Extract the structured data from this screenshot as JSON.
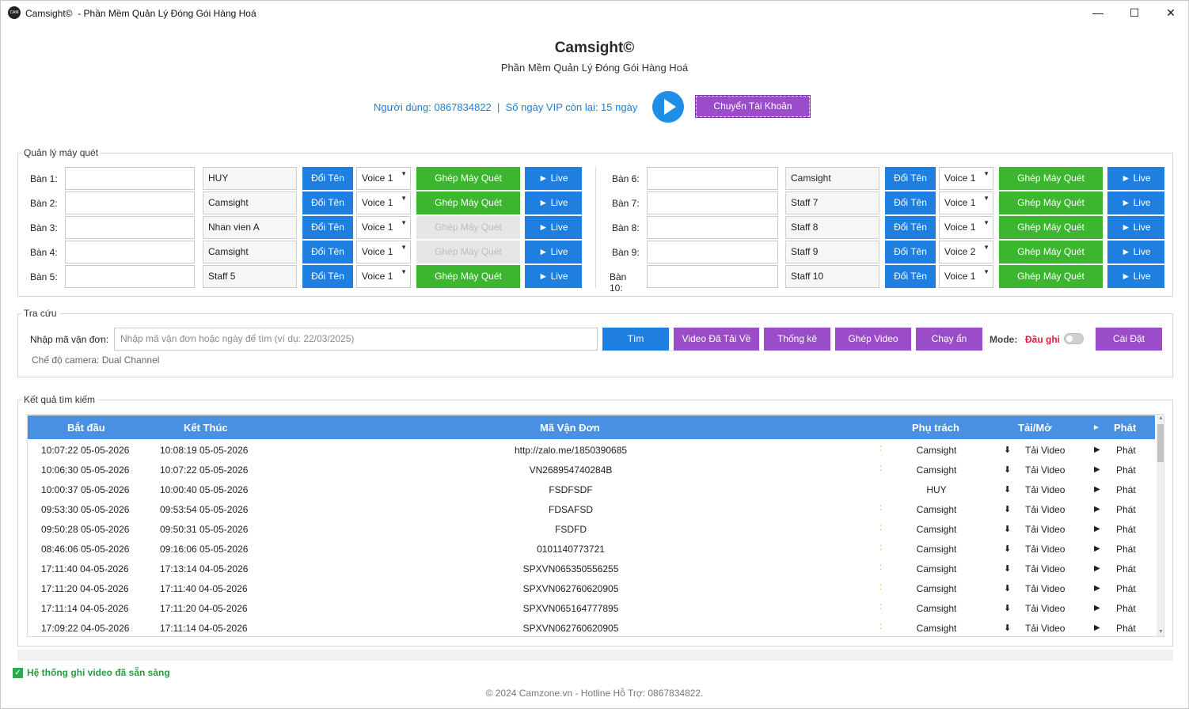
{
  "window": {
    "icon_text": "CAM",
    "title": "Camsight©  - Phần Mềm Quản Lý Đóng Gói Hàng Hoá",
    "minimize": "—",
    "maximize": "☐",
    "close": "✕"
  },
  "header": {
    "title": "Camsight©",
    "subtitle": "Phần Mềm Quản Lý Đóng Gói Hàng Hoá",
    "user_info": "Người dùng: 0867834822  |  Số ngày VIP còn lại: 15 ngày",
    "switch_account": "Chuyển Tài Khoản"
  },
  "scanners": {
    "group_label": "Quản lý máy quét",
    "rename_label": "Đổi Tên",
    "pair_label": "Ghép Máy Quét",
    "live_label": "► Live",
    "left": [
      {
        "label": "Bàn 1:",
        "name": "HUY",
        "voice": "Voice 1",
        "paired_enabled": true
      },
      {
        "label": "Bàn 2:",
        "name": "Camsight",
        "voice": "Voice 1",
        "paired_enabled": true
      },
      {
        "label": "Bàn 3:",
        "name": "Nhan vien A",
        "voice": "Voice 1",
        "paired_enabled": false
      },
      {
        "label": "Bàn 4:",
        "name": "Camsight",
        "voice": "Voice 1",
        "paired_enabled": false
      },
      {
        "label": "Bàn 5:",
        "name": "Staff 5",
        "voice": "Voice 1",
        "paired_enabled": true
      }
    ],
    "right": [
      {
        "label": "Bàn 6:",
        "name": "Camsight",
        "voice": "Voice 1",
        "paired_enabled": true
      },
      {
        "label": "Bàn 7:",
        "name": "Staff 7",
        "voice": "Voice 1",
        "paired_enabled": true
      },
      {
        "label": "Bàn 8:",
        "name": "Staff 8",
        "voice": "Voice 1",
        "paired_enabled": true
      },
      {
        "label": "Bàn 9:",
        "name": "Staff 9",
        "voice": "Voice 2",
        "paired_enabled": true
      },
      {
        "label": "Bàn 10:",
        "name": "Staff 10",
        "voice": "Voice 1",
        "paired_enabled": true
      }
    ]
  },
  "lookup": {
    "group_label": "Tra cứu",
    "input_label": "Nhập mã vận đơn:",
    "placeholder": "Nhập mã vận đơn hoặc ngày để tìm (ví dụ: 22/03/2025)",
    "search": "Tìm",
    "downloaded": "Video Đã Tải Về",
    "stats": "Thống kê",
    "merge": "Ghép Video",
    "hidden": "Chạy ẩn",
    "mode_label": "Mode:",
    "mode_value": "Đầu ghi",
    "settings": "Cài Đặt",
    "camera_mode": "Chế độ camera: Dual Channel"
  },
  "results": {
    "group_label": "Kết quả tìm kiếm",
    "columns": {
      "start": "Bắt đầu",
      "end": "Kết Thúc",
      "code": "Mã Vận Đơn",
      "owner": "Phụ trách",
      "download": "Tải/Mở",
      "play_icon": "►",
      "play": "Phát"
    },
    "download_icon": "⬇",
    "download_text": "Tải Video",
    "play_icon": "▶",
    "play_text": "Phát",
    "rows": [
      {
        "start": "10:07:22 05-05-2026",
        "end": "10:08:19 05-05-2026",
        "code": "http://zalo.me/1850390685",
        "owner": "Camsight",
        "dot": true
      },
      {
        "start": "10:06:30 05-05-2026",
        "end": "10:07:22 05-05-2026",
        "code": "VN268954740284B",
        "owner": "Camsight",
        "dot": true
      },
      {
        "start": "10:00:37 05-05-2026",
        "end": "10:00:40 05-05-2026",
        "code": "FSDFSDF",
        "owner": "HUY",
        "dot": false
      },
      {
        "start": "09:53:30 05-05-2026",
        "end": "09:53:54 05-05-2026",
        "code": "FDSAFSD",
        "owner": "Camsight",
        "dot": true
      },
      {
        "start": "09:50:28 05-05-2026",
        "end": "09:50:31 05-05-2026",
        "code": "FSDFD",
        "owner": "Camsight",
        "dot": true
      },
      {
        "start": "08:46:06 05-05-2026",
        "end": "09:16:06 05-05-2026",
        "code": "0101140773721",
        "owner": "Camsight",
        "dot": true
      },
      {
        "start": "17:11:40 04-05-2026",
        "end": "17:13:14 04-05-2026",
        "code": "SPXVN065350556255",
        "owner": "Camsight",
        "dot": true
      },
      {
        "start": "17:11:20 04-05-2026",
        "end": "17:11:40 04-05-2026",
        "code": "SPXVN062760620905",
        "owner": "Camsight",
        "dot": true
      },
      {
        "start": "17:11:14 04-05-2026",
        "end": "17:11:20 04-05-2026",
        "code": "SPXVN065164777895",
        "owner": "Camsight",
        "dot": true
      },
      {
        "start": "17:09:22 04-05-2026",
        "end": "17:11:14 04-05-2026",
        "code": "SPXVN062760620905",
        "owner": "Camsight",
        "dot": true
      }
    ]
  },
  "status": {
    "icon": "✓",
    "text": "Hệ thống ghi video đã sẵn sàng"
  },
  "footer": "© 2024 Camzone.vn - Hotline Hỗ Trợ: 0867834822."
}
